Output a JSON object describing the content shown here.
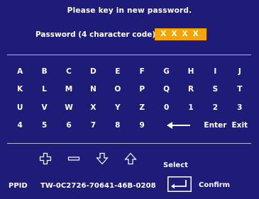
{
  "dialog": {
    "title": "Please key in new password.",
    "password_label": "Password (4 character code):",
    "password_value": "XXXX"
  },
  "keyboard": {
    "rows": [
      [
        "A",
        "B",
        "C",
        "D",
        "E",
        "F",
        "G",
        "H",
        "I",
        "J"
      ],
      [
        "K",
        "L",
        "M",
        "N",
        "O",
        "P",
        "Q",
        "R",
        "S",
        "T"
      ],
      [
        "U",
        "V",
        "W",
        "X",
        "Y",
        "Z",
        "0",
        "1",
        "2",
        "3"
      ],
      [
        "4",
        "5",
        "6",
        "7",
        "8",
        "9"
      ]
    ],
    "backspace_icon": "left-arrow-icon",
    "enter_label": "Enter",
    "exit_label": "Exit"
  },
  "navigation": {
    "icons": [
      "plus-icon",
      "minus-icon",
      "down-arrow-icon",
      "up-arrow-icon"
    ],
    "select_label": "Select"
  },
  "footer": {
    "ppid_label": "PPID",
    "ppid_value": "TW-0C2726-70641-46B-0208",
    "enter_icon": "enter-key-icon",
    "confirm_label": "Confirm"
  },
  "colors": {
    "background": "#1e1b79",
    "highlight": "#f5a400",
    "text": "#ffffff"
  }
}
